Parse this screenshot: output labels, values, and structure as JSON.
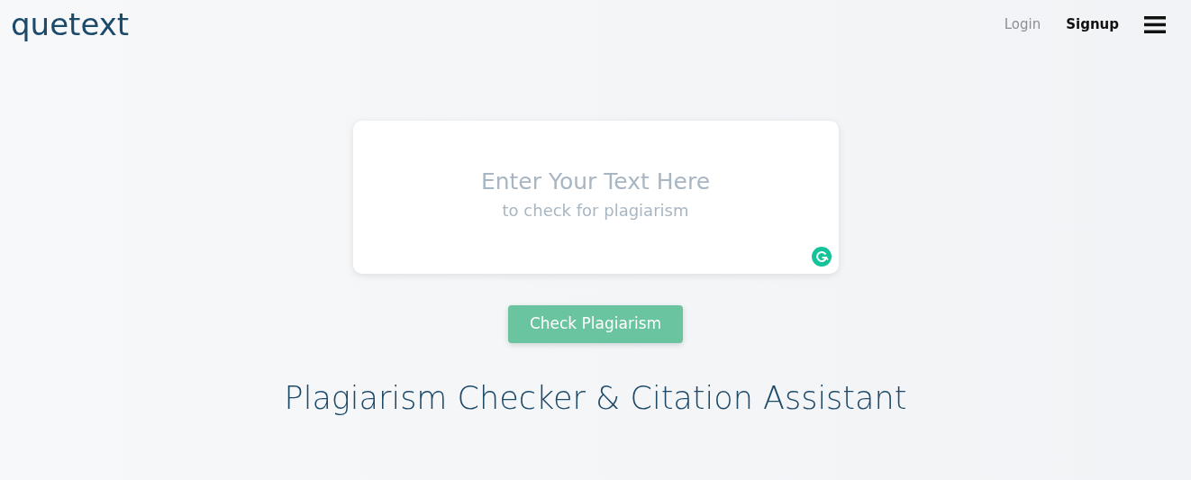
{
  "header": {
    "logo": "quetext",
    "links": [
      {
        "label": "Login",
        "emphasized": false
      },
      {
        "label": "Signup",
        "emphasized": true
      }
    ]
  },
  "editor": {
    "placeholder": "Enter Your Text Here",
    "placeholder_subtitle": "to check for plagiarism"
  },
  "button": {
    "label": "Check Plagiarism"
  },
  "heading": "Plagiarism Checker & Citation Assistant"
}
